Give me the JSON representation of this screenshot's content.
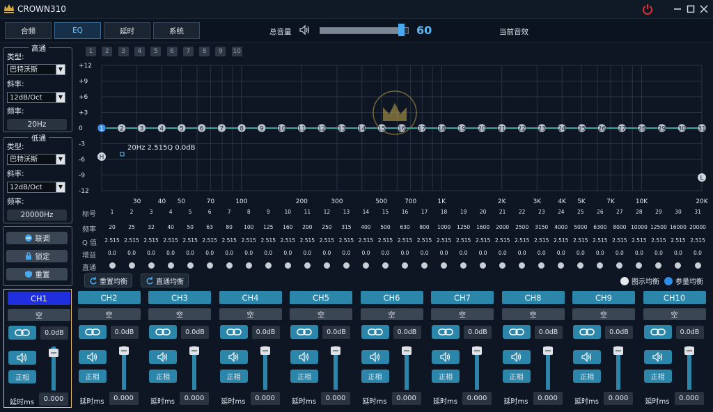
{
  "window": {
    "title": "CROWN310"
  },
  "tabs": [
    {
      "label": "合频",
      "active": false
    },
    {
      "label": "EQ",
      "active": true
    },
    {
      "label": "延时",
      "active": false
    },
    {
      "label": "系统",
      "active": false
    }
  ],
  "master": {
    "label": "总音量",
    "value": "60",
    "level_fraction": 0.6
  },
  "preset": {
    "label": "当前音效"
  },
  "highpass": {
    "title": "高通",
    "type_label": "类型:",
    "type_value": "巴特沃斯",
    "slope_label": "斜率:",
    "slope_value": "12dB/Oct",
    "freq_label": "频率:",
    "freq_value": "20Hz"
  },
  "lowpass": {
    "title": "低通",
    "type_label": "类型:",
    "type_value": "巴特沃斯",
    "slope_label": "斜率:",
    "slope_value": "12dB/Oct",
    "freq_label": "频率:",
    "freq_value": "20000Hz"
  },
  "actions": {
    "link": "联调",
    "lock": "锁定",
    "reset": "重置"
  },
  "presets": [
    "1",
    "2",
    "3",
    "4",
    "5",
    "6",
    "7",
    "8",
    "9",
    "10"
  ],
  "graph": {
    "y_ticks": [
      "+12",
      "+9",
      "+6",
      "+3",
      "0",
      "-3",
      "-6",
      "-9",
      "-12"
    ],
    "x_ticks": [
      "30",
      "40",
      "50",
      "70",
      "100",
      "200",
      "300",
      "500",
      "700",
      "1K",
      "2K",
      "3K",
      "4K",
      "5K",
      "7K",
      "10K",
      "20K"
    ],
    "point_label": "20Hz 2.515Q 0.0dB",
    "h_marker": "H",
    "l_marker": "L"
  },
  "table": {
    "band_label": "标号",
    "freq_label": "频率",
    "q_label": "Q 值",
    "gain_label": "增益",
    "bypass_label": "直通",
    "bands": [
      "1",
      "2",
      "3",
      "4",
      "5",
      "6",
      "7",
      "8",
      "9",
      "10",
      "11",
      "12",
      "13",
      "14",
      "15",
      "16",
      "17",
      "18",
      "19",
      "20",
      "21",
      "22",
      "23",
      "24",
      "25",
      "26",
      "27",
      "28",
      "29",
      "30",
      "31"
    ],
    "freqs": [
      "20",
      "25",
      "32",
      "40",
      "50",
      "63",
      "80",
      "100",
      "125",
      "160",
      "200",
      "250",
      "315",
      "400",
      "500",
      "630",
      "800",
      "1000",
      "1250",
      "1600",
      "2000",
      "2500",
      "3150",
      "4000",
      "5000",
      "6300",
      "8000",
      "10000",
      "12500",
      "16000",
      "20000"
    ],
    "q": [
      "2.515",
      "2.515",
      "2.515",
      "2.515",
      "2.515",
      "2.515",
      "2.515",
      "2.515",
      "2.515",
      "2.515",
      "2.515",
      "2.515",
      "2.515",
      "2.515",
      "2.515",
      "2.515",
      "2.515",
      "2.515",
      "2.515",
      "2.515",
      "2.515",
      "2.515",
      "2.515",
      "2.515",
      "2.515",
      "2.515",
      "2.515",
      "2.515",
      "2.515",
      "2.515",
      "2.515"
    ],
    "gain": [
      "0.0",
      "0.0",
      "0.0",
      "0.0",
      "0.0",
      "0.0",
      "0.0",
      "0.0",
      "0.0",
      "0.0",
      "0.0",
      "0.0",
      "0.0",
      "0.0",
      "0.0",
      "0.0",
      "0.0",
      "0.0",
      "0.0",
      "0.0",
      "0.0",
      "0.0",
      "0.0",
      "0.0",
      "0.0",
      "0.0",
      "0.0",
      "0.0",
      "0.0",
      "0.0",
      "0.0"
    ]
  },
  "eq_buttons": {
    "reset_eq": "重置均衡",
    "bypass_eq": "直通均衡"
  },
  "eq_mode": {
    "graphic": "图示均衡",
    "parametric": "参量均衡"
  },
  "channels": [
    {
      "name": "CH1",
      "slot": "空",
      "gain": "0.0dB",
      "phase": "正相",
      "delay_label": "延时ms",
      "delay": "0.000",
      "selected": true
    },
    {
      "name": "CH2",
      "slot": "空",
      "gain": "0.0dB",
      "phase": "正相",
      "delay_label": "延时ms",
      "delay": "0.000",
      "selected": false
    },
    {
      "name": "CH3",
      "slot": "空",
      "gain": "0.0dB",
      "phase": "正相",
      "delay_label": "延时ms",
      "delay": "0.000",
      "selected": false
    },
    {
      "name": "CH4",
      "slot": "空",
      "gain": "0.0dB",
      "phase": "正相",
      "delay_label": "延时ms",
      "delay": "0.000",
      "selected": false
    },
    {
      "name": "CH5",
      "slot": "空",
      "gain": "0.0dB",
      "phase": "正相",
      "delay_label": "延时ms",
      "delay": "0.000",
      "selected": false
    },
    {
      "name": "CH6",
      "slot": "空",
      "gain": "0.0dB",
      "phase": "正相",
      "delay_label": "延时ms",
      "delay": "0.000",
      "selected": false
    },
    {
      "name": "CH7",
      "slot": "空",
      "gain": "0.0dB",
      "phase": "正相",
      "delay_label": "延时ms",
      "delay": "0.000",
      "selected": false
    },
    {
      "name": "CH8",
      "slot": "空",
      "gain": "0.0dB",
      "phase": "正相",
      "delay_label": "延时ms",
      "delay": "0.000",
      "selected": false
    },
    {
      "name": "CH9",
      "slot": "空",
      "gain": "0.0dB",
      "phase": "正相",
      "delay_label": "延时ms",
      "delay": "0.000",
      "selected": false
    },
    {
      "name": "CH10",
      "slot": "空",
      "gain": "0.0dB",
      "phase": "正相",
      "delay_label": "延时ms",
      "delay": "0.000",
      "selected": false
    }
  ],
  "colors": {
    "accent": "#2b86aa",
    "selected": "#1f2fe0",
    "value_blue": "#5fb4ee",
    "curve": "#3aa7a0",
    "power": "#e03030"
  }
}
